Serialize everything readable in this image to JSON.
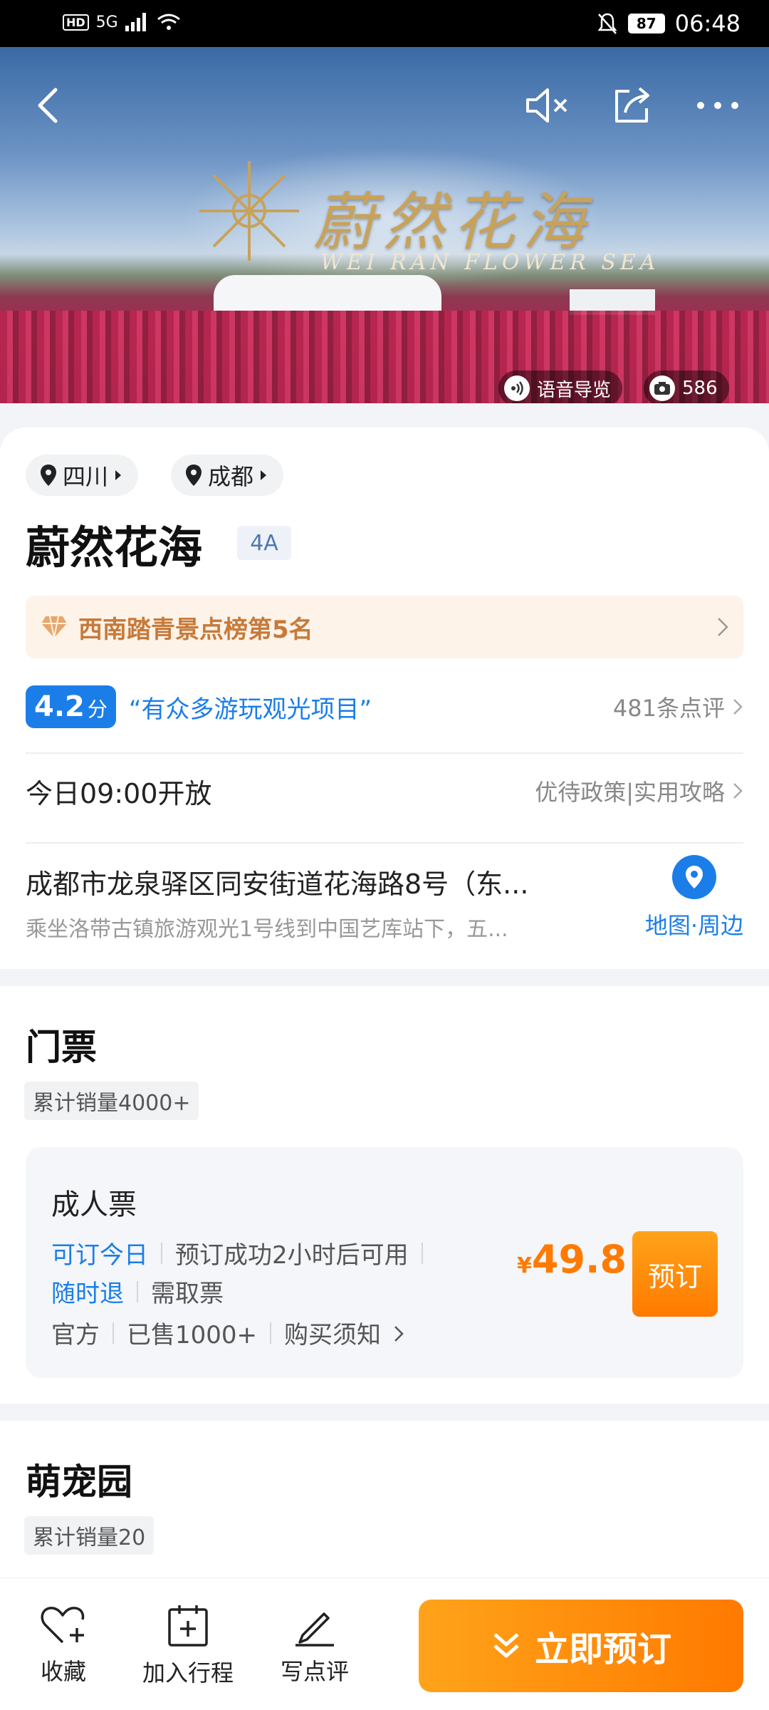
{
  "status_bar": {
    "network": "5G",
    "hd": "HD",
    "battery": "87",
    "time": "06:48"
  },
  "hero": {
    "logo_text": "蔚然花海",
    "logo_subtitle": "WEI RAN FLOWER SEA",
    "audio_guide_label": "语音导览",
    "photo_count": "586"
  },
  "location": {
    "province": "四川",
    "city": "成都"
  },
  "attraction": {
    "name": "蔚然花海",
    "level": "4A"
  },
  "ranking": {
    "text": "西南踏青景点榜第5名"
  },
  "rating": {
    "score": "4.2",
    "unit": "分",
    "quote": "“有众多游玩观光项目”",
    "review_count": "481条点评"
  },
  "hours": {
    "open_text": "今日09:00开放",
    "links": "优待政策|实用攻略"
  },
  "address": {
    "line1": "成都市龙泉驿区同安街道花海路8号（东...",
    "line2": "乘坐洛带古镇旅游观光1号线到中国艺库站下，五...",
    "map_label": "地图·周边"
  },
  "tickets": {
    "section_title": "门票",
    "sales_label": "累计销量4000+",
    "item": {
      "name": "成人票",
      "tag_today": "可订今日",
      "tag_available": "预订成功2小时后可用",
      "tag_refund": "随时退",
      "tag_pickup": "需取票",
      "tag_official": "官方",
      "tag_sold": "已售1000+",
      "tag_notice": "购买须知",
      "currency": "¥",
      "price": "49.8",
      "book_label": "预订"
    }
  },
  "pet_park": {
    "section_title": "萌宠园",
    "sales_label": "累计销量20"
  },
  "bottom_bar": {
    "favorite_label": "收藏",
    "add_trip_label": "加入行程",
    "review_label": "写点评",
    "book_now_label": "立即预订"
  },
  "colors": {
    "primary_blue": "#1b7ee8",
    "accent_orange": "#ff7a00",
    "rank_text": "#c77a3a"
  }
}
